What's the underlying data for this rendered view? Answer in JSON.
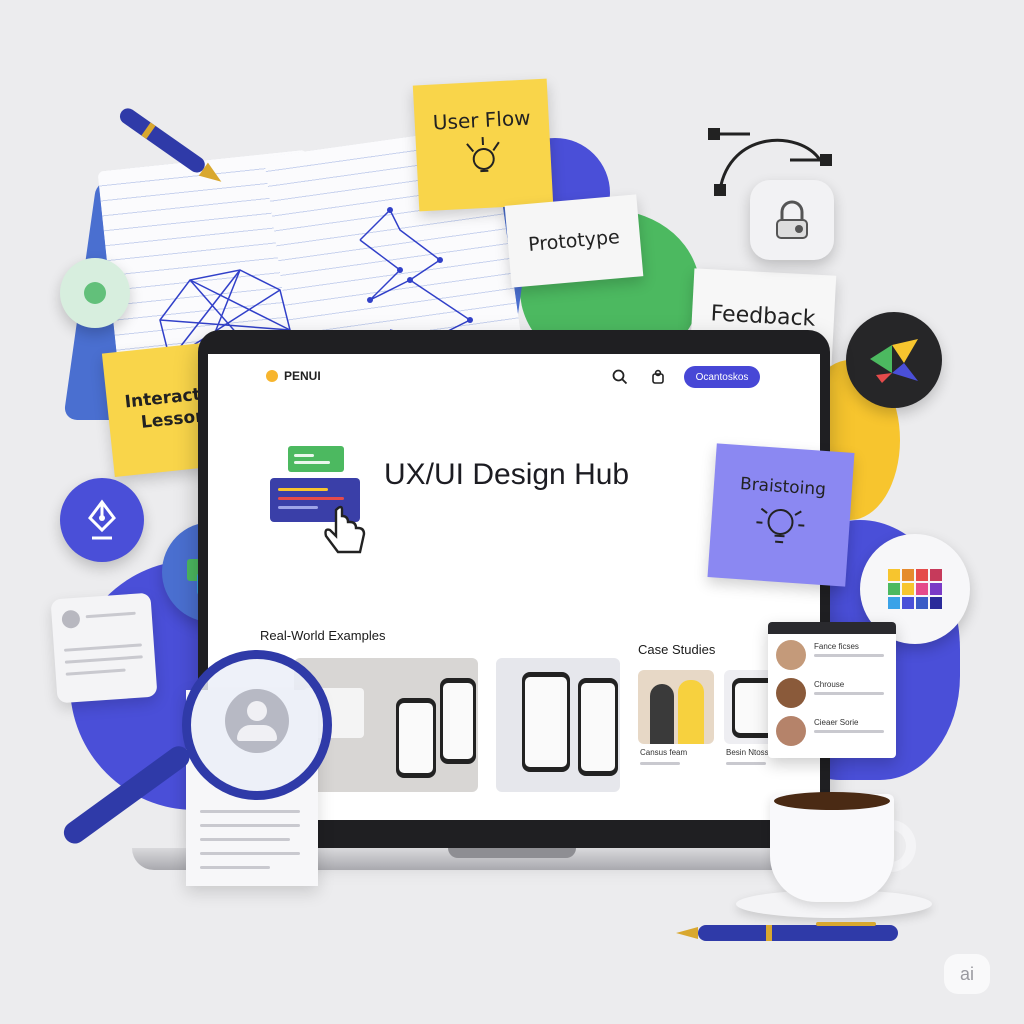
{
  "notes": {
    "user_flow": "User Flow",
    "prototype": "Prototype",
    "feedback": "Feedback",
    "interactive_lessons_line1": "Interactive",
    "interactive_lessons_line2": "Lessons",
    "brainstorming": "Braistoing"
  },
  "site": {
    "brand": "PENUI",
    "cta_label": "Ocantoskos",
    "hero_title": "UX/UI Design Hub",
    "real_world_title": "Real-World Examples",
    "case_studies_title": "Case Studies",
    "case_labels": [
      "Cansus feam",
      "Besin Ntoss"
    ],
    "profile_card_names": [
      "Fance ficses",
      "Chrouse",
      "Cieaer Sorie"
    ]
  },
  "colors": {
    "primary_blue": "#4a4fd8",
    "yellow": "#f7d13e",
    "green": "#4cb960",
    "lavender": "#8b88f2",
    "dark": "#1f1f22"
  },
  "icons": [
    "pen-icon",
    "bezier-curve-icon",
    "lock-icon",
    "figma-like-logo-icon",
    "pen-tool-icon",
    "color-blocks-icon",
    "palette-grid-icon",
    "magnifier-icon",
    "user-icon",
    "search-icon",
    "notification-icon",
    "lightbulb-icon",
    "pointer-hand-icon",
    "coffee-cup-icon"
  ],
  "watermark": "ai"
}
